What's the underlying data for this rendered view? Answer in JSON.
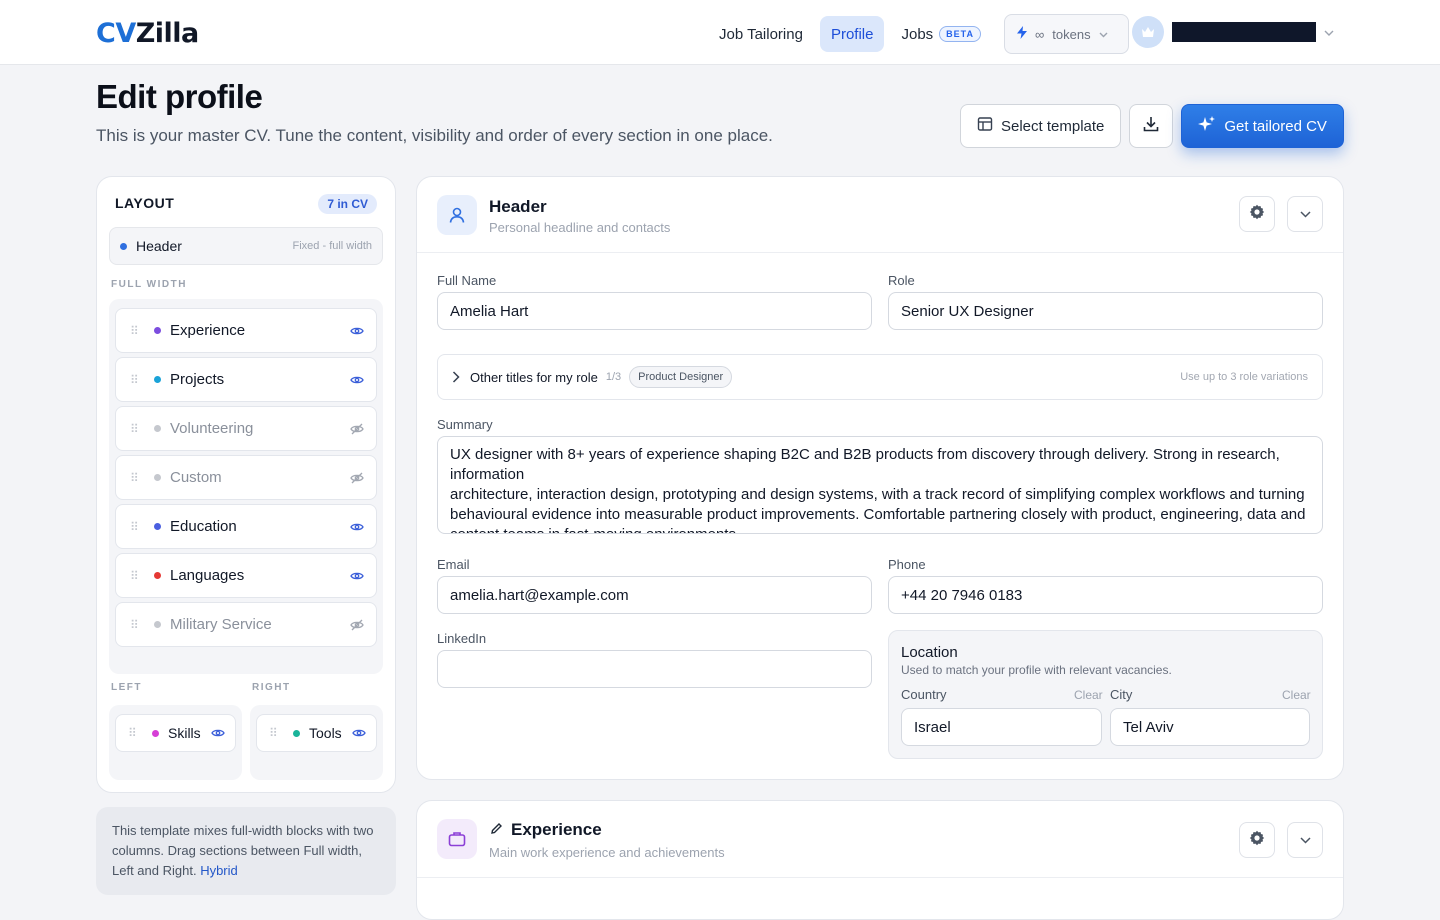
{
  "app": {
    "logo_cv": "CV",
    "logo_zilla": "Zilla"
  },
  "nav": {
    "items": [
      {
        "label": "Job Tailoring"
      },
      {
        "label": "Profile"
      },
      {
        "label": "Jobs",
        "badge": "BETA"
      }
    ],
    "tokens_symbol": "∞",
    "tokens_label": "tokens"
  },
  "page": {
    "title": "Edit profile",
    "subtitle": "This is your master CV. Tune the content, visibility and order of every section in one place.",
    "select_template": "Select template",
    "get_tailored": "Get tailored CV"
  },
  "layout": {
    "heading": "LAYOUT",
    "count": "7 in CV",
    "header_item": {
      "label": "Header",
      "note": "Fixed - full width"
    },
    "full_width_label": "FULL WIDTH",
    "full_width_items": [
      {
        "label": "Experience",
        "visible": true,
        "color": "#7c4ddf"
      },
      {
        "label": "Projects",
        "visible": true,
        "color": "#1aa3d8"
      },
      {
        "label": "Volunteering",
        "visible": false,
        "color": "#c5c8ce"
      },
      {
        "label": "Custom",
        "visible": false,
        "color": "#c5c8ce"
      },
      {
        "label": "Education",
        "visible": true,
        "color": "#4a5fe0"
      },
      {
        "label": "Languages",
        "visible": true,
        "color": "#e53935"
      },
      {
        "label": "Military Service",
        "visible": false,
        "color": "#c5c8ce"
      }
    ],
    "left_label": "LEFT",
    "right_label": "RIGHT",
    "left_items": [
      {
        "label": "Skills",
        "visible": true,
        "color": "#d63fd6"
      }
    ],
    "right_items": [
      {
        "label": "Tools",
        "visible": true,
        "color": "#1ab49a"
      }
    ],
    "hint_text": "This template mixes full-width blocks with two columns. Drag sections between Full width, Left and Right.",
    "hint_link": "Hybrid"
  },
  "header_card": {
    "title": "Header",
    "subtitle": "Personal headline and contacts",
    "full_name_label": "Full Name",
    "full_name": "Amelia Hart",
    "role_label": "Role",
    "role": "Senior UX Designer",
    "other_titles_label": "Other titles for my role",
    "other_titles_count": "1/3",
    "other_titles_chip": "Product Designer",
    "other_titles_hint": "Use up to 3 role variations",
    "summary_label": "Summary",
    "summary_lines": [
      "UX designer with 8+ years of experience shaping B2C and B2B products from discovery through delivery. Strong in research,",
      "information",
      "architecture, interaction design, prototyping and design systems, with a track record of simplifying complex workflows and turning",
      "behavioural evidence into measurable product improvements. Comfortable partnering closely with product, engineering, data and",
      "content teams in fast-moving environments."
    ],
    "email_label": "Email",
    "email": "amelia.hart@example.com",
    "phone_label": "Phone",
    "phone": "+44 20 7946 0183",
    "linkedin_label": "LinkedIn",
    "linkedin": "",
    "location_title": "Location",
    "location_sub": "Used to match your profile with relevant vacancies.",
    "country_label": "Country",
    "country": "Israel",
    "city_label": "City",
    "city": "Tel Aviv",
    "clear_label": "Clear"
  },
  "experience_card": {
    "title": "Experience",
    "subtitle": "Main work experience and achievements"
  },
  "colors": {
    "accent": "#1e63d6",
    "nav_active_bg": "#dbe7fb"
  }
}
